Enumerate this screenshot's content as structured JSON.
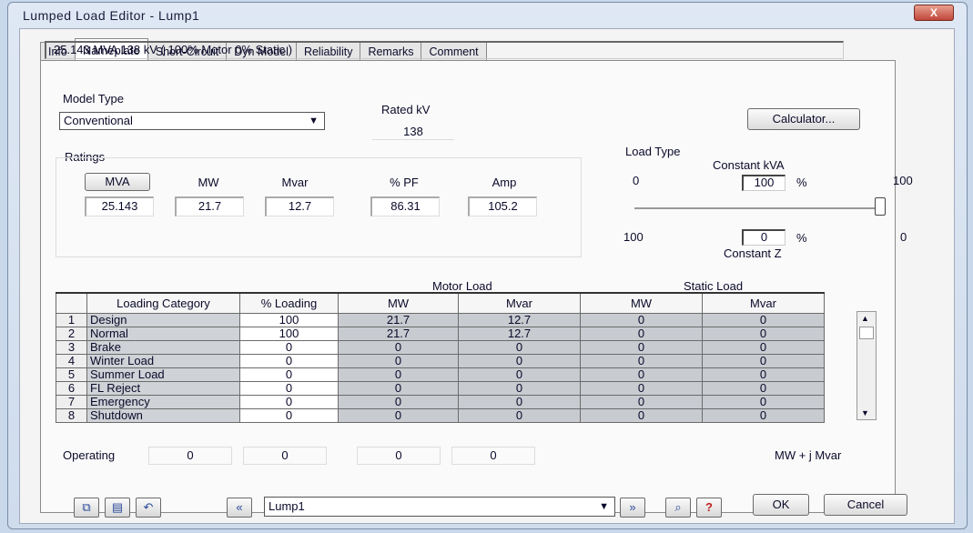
{
  "window": {
    "title": "Lumped Load Editor - Lump1",
    "close_label": "X"
  },
  "tabs": [
    "Info",
    "Nameplate",
    "Short-Circuit",
    "Dyn Model",
    "Reliability",
    "Remarks",
    "Comment"
  ],
  "summary": "25.143 MVA   138 kV  ( 100% Motor   0% Static )",
  "model_type": {
    "label": "Model Type",
    "value": "Conventional"
  },
  "rated_kv": {
    "label": "Rated kV",
    "value": "138"
  },
  "calculator_label": "Calculator...",
  "ratings": {
    "label": "Ratings",
    "headers": [
      "MVA",
      "MW",
      "Mvar",
      "% PF",
      "Amp"
    ],
    "values": [
      "25.143",
      "21.7",
      "12.7",
      "86.31",
      "105.2"
    ]
  },
  "load_type": {
    "label": "Load Type",
    "constant_kva_label": "Constant kVA",
    "constant_z_label": "Constant Z",
    "kva_pct": "100",
    "z_pct": "0",
    "pct_symbol": "%",
    "left_top": "0",
    "right_top": "100",
    "left_bottom": "100",
    "right_bottom": "0",
    "slider_fraction": 1.0
  },
  "table": {
    "group_motor": "Motor Load",
    "group_static": "Static Load",
    "headers": [
      "Loading Category",
      "% Loading",
      "MW",
      "Mvar",
      "MW",
      "Mvar"
    ],
    "rows": [
      {
        "n": "1",
        "cat": "Design",
        "load": "100",
        "mw": "21.7",
        "mvar": "12.7",
        "smw": "0",
        "smvar": "0"
      },
      {
        "n": "2",
        "cat": "Normal",
        "load": "100",
        "mw": "21.7",
        "mvar": "12.7",
        "smw": "0",
        "smvar": "0"
      },
      {
        "n": "3",
        "cat": "Brake",
        "load": "0",
        "mw": "0",
        "mvar": "0",
        "smw": "0",
        "smvar": "0"
      },
      {
        "n": "4",
        "cat": "Winter Load",
        "load": "0",
        "mw": "0",
        "mvar": "0",
        "smw": "0",
        "smvar": "0"
      },
      {
        "n": "5",
        "cat": "Summer Load",
        "load": "0",
        "mw": "0",
        "mvar": "0",
        "smw": "0",
        "smvar": "0"
      },
      {
        "n": "6",
        "cat": "FL Reject",
        "load": "0",
        "mw": "0",
        "mvar": "0",
        "smw": "0",
        "smvar": "0"
      },
      {
        "n": "7",
        "cat": "Emergency",
        "load": "0",
        "mw": "0",
        "mvar": "0",
        "smw": "0",
        "smvar": "0"
      },
      {
        "n": "8",
        "cat": "Shutdown",
        "load": "0",
        "mw": "0",
        "mvar": "0",
        "smw": "0",
        "smvar": "0"
      }
    ]
  },
  "operating": {
    "label": "Operating",
    "values": [
      "0",
      "0",
      "0",
      "0"
    ],
    "units": "MW + j  Mvar"
  },
  "bottom": {
    "nav_value": "Lump1",
    "ok_label": "OK",
    "cancel_label": "Cancel",
    "icons": [
      "copy-icon",
      "paste-icon",
      "undo-icon",
      "prev-icon",
      "next-icon",
      "find-icon",
      "help-icon"
    ]
  }
}
